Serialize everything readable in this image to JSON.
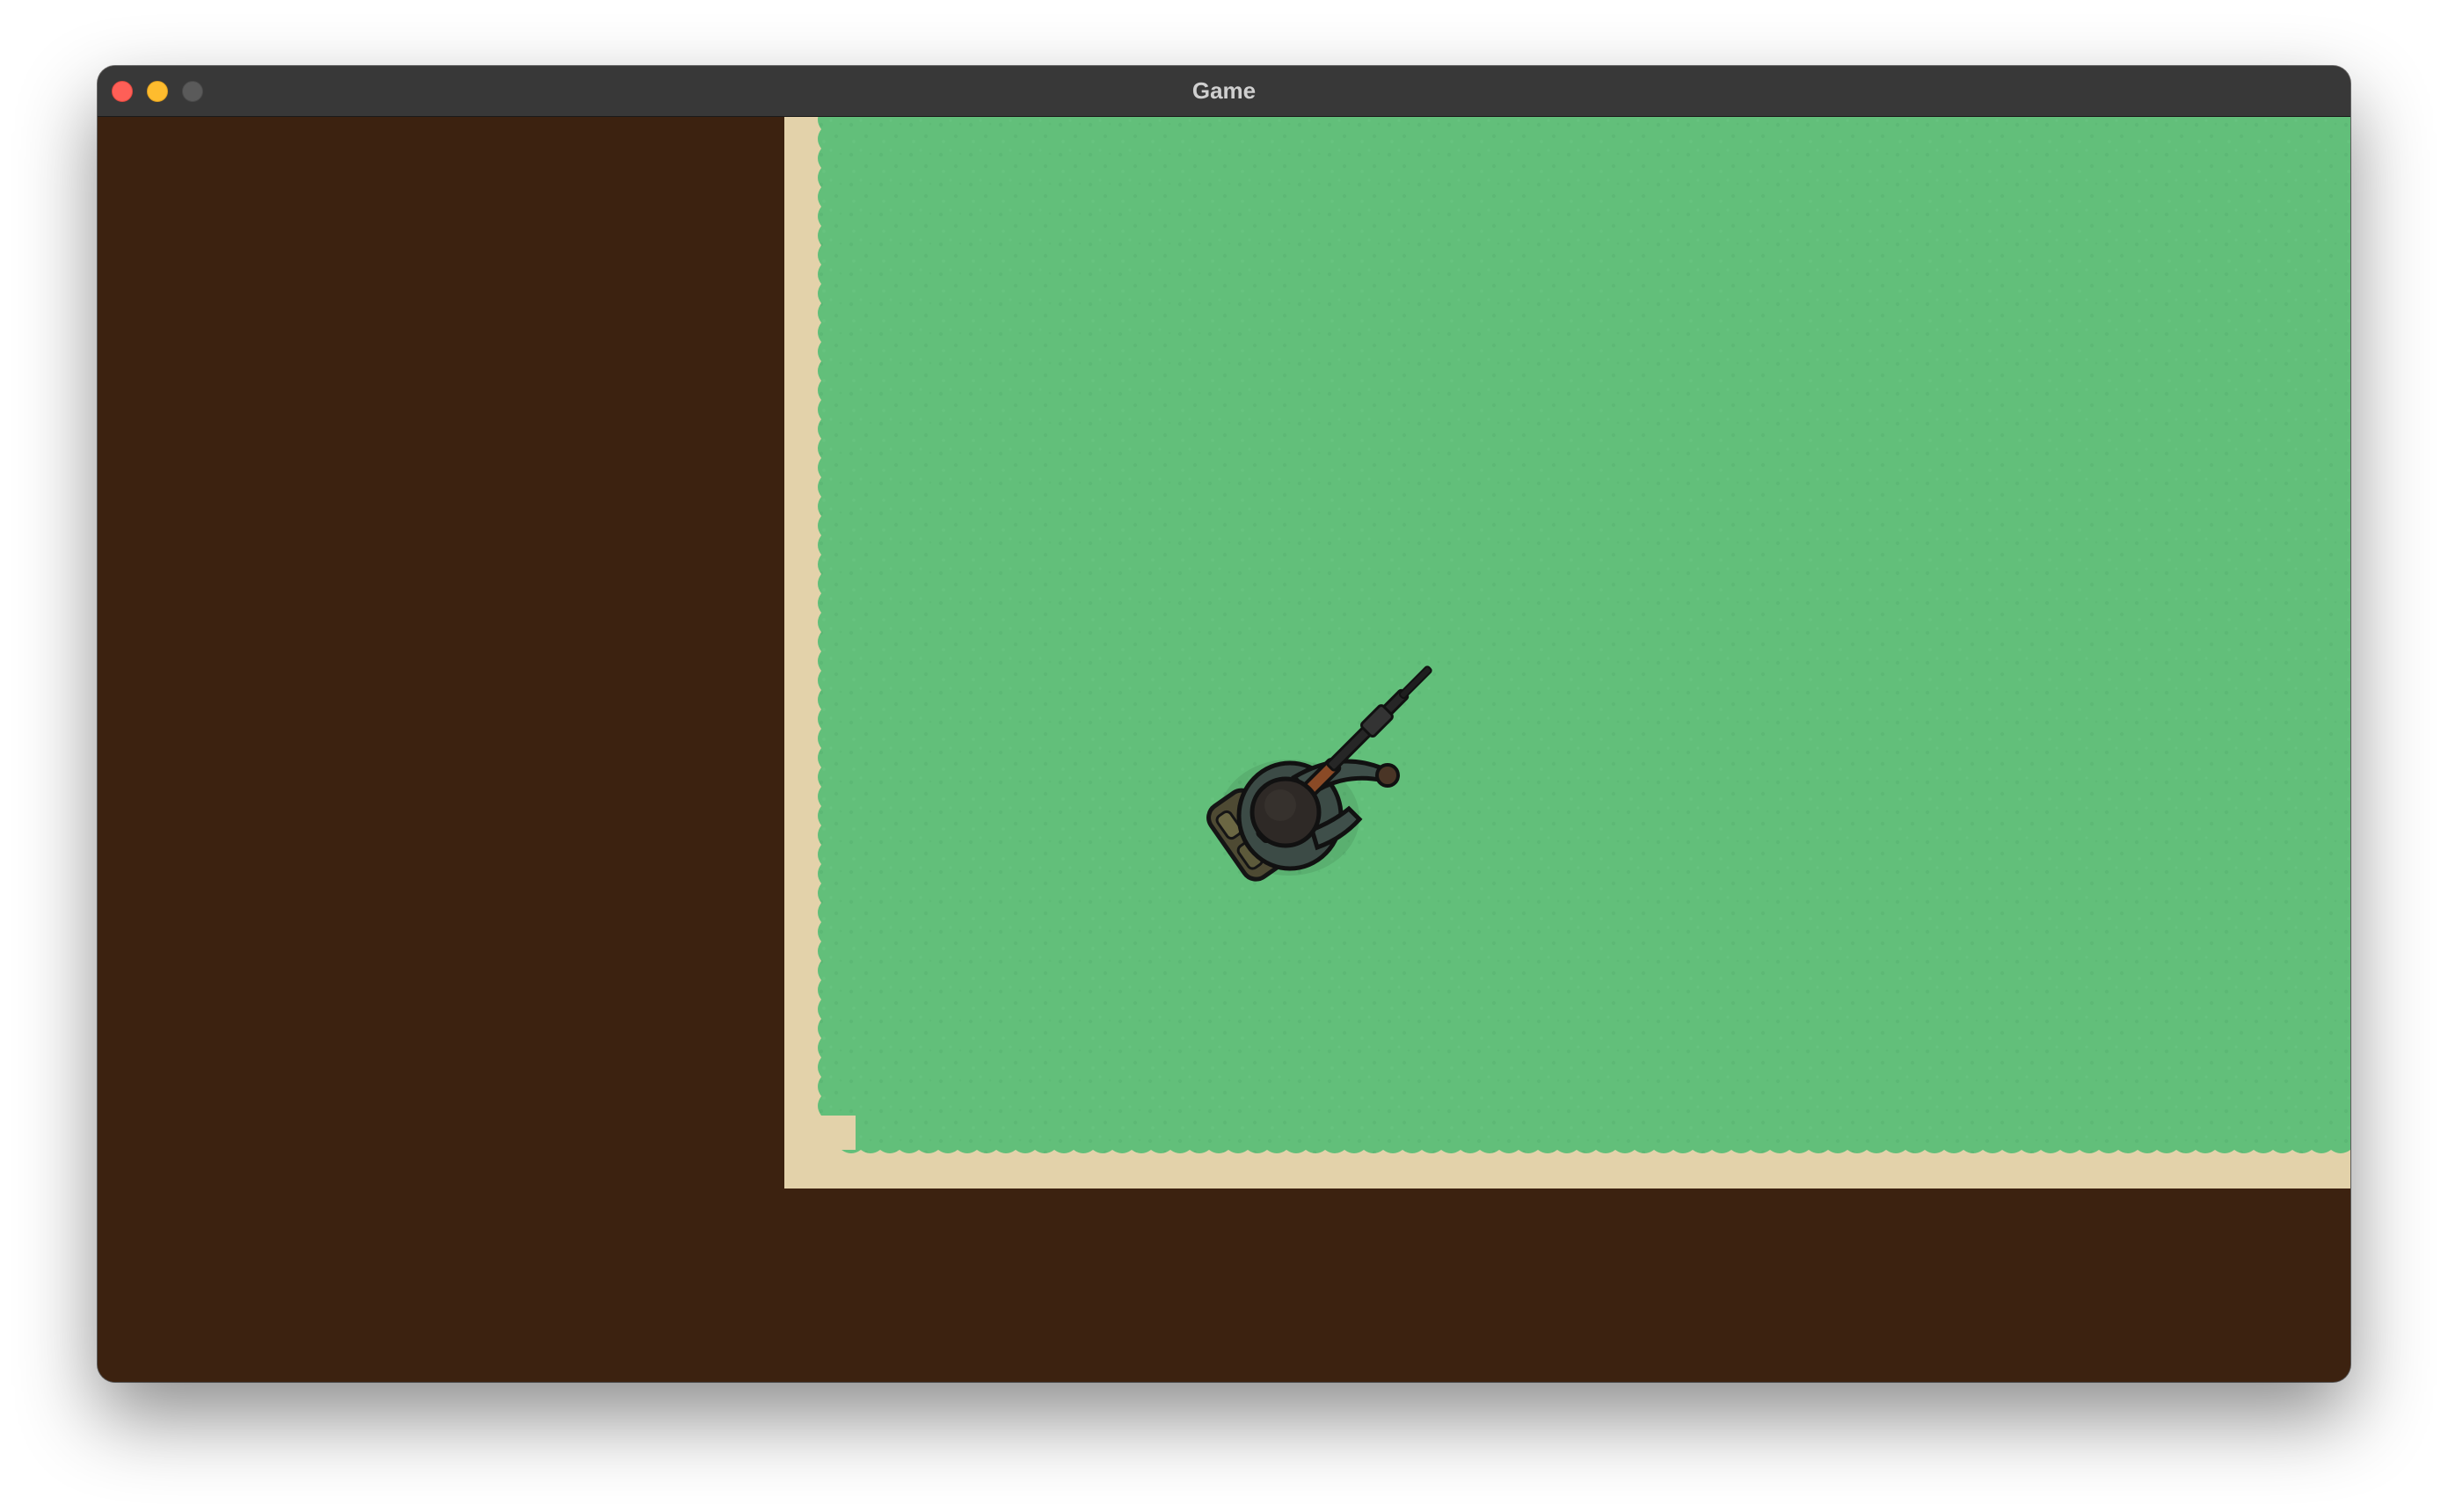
{
  "window": {
    "title": "Game",
    "controls": [
      "close",
      "minimize",
      "zoom"
    ]
  },
  "scene": {
    "background_color": "#3c2210",
    "tiles": {
      "grass_color": "#62bf7a",
      "sand_color": "#e3d2aa",
      "void_color": "#3c2210"
    },
    "player": {
      "sprite": "soldier-with-rifle",
      "view": "top-down",
      "facing": "north-east"
    }
  }
}
